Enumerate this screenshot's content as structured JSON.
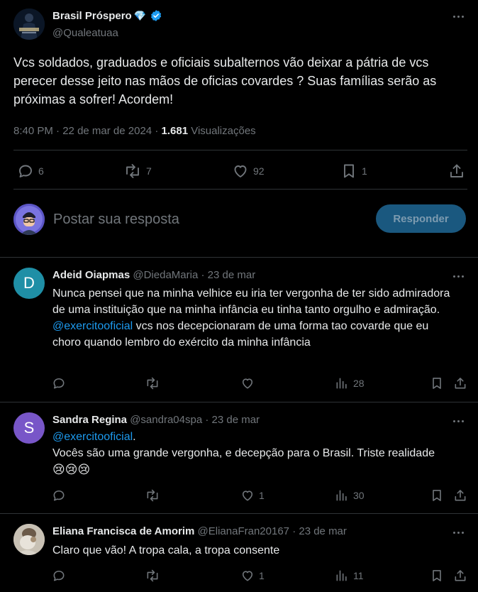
{
  "colors": {
    "background": "#000000",
    "text": "#e7e9ea",
    "muted": "#71767b",
    "accent": "#1d9bf0",
    "divider": "#2f3336",
    "verified": "#1d9bf0"
  },
  "main_post": {
    "author_name": "Brasil Próspero",
    "author_emoji": "💎",
    "verified_icon": "verified-badge-icon",
    "handle": "@Qualeatuaa",
    "text": "Vcs soldados, graduados e oficiais subalternos vão deixar a pátria de vcs perecer desse jeito nas mãos de oficias covardes ? Suas famílias serão as próximas a sofrer! Acordem!",
    "time": "8:40 PM",
    "date": "22 de mar de 2024",
    "views": "1.681",
    "views_label": "Visualizações",
    "actions": {
      "replies": "6",
      "reposts": "7",
      "likes": "92",
      "bookmarks": "1"
    }
  },
  "composer": {
    "placeholder": "Postar sua resposta",
    "button": "Responder"
  },
  "replies": [
    {
      "avatar_letter": "D",
      "avatar_color": "#1f8fa6",
      "name": "Adeid Oiapmas",
      "handle": "@DiedaMaria",
      "date": "23 de mar",
      "text_before": "Nunca pensei que na minha velhice eu iria ter vergonha de ter sido admiradora de uma instituição que na minha infância eu tinha tanto orgulho e admiração. ",
      "mention": "@exercitooficial",
      "text_after": " vcs nos decepcionaram de uma forma tao covarde que eu choro quando lembro do exército da minha infância",
      "actions": {
        "replies": "",
        "reposts": "",
        "likes": "",
        "views": "28"
      }
    },
    {
      "avatar_letter": "S",
      "avatar_color": "#7856c8",
      "name": "Sandra Regina",
      "handle": "@sandra04spa",
      "date": "23 de mar",
      "mention": "@exercitooficial",
      "mention_suffix": ".",
      "text": "Vocês são uma grande vergonha, e decepção para o Brasil. Triste realidade",
      "emojis": "😢😢😢",
      "actions": {
        "replies": "",
        "reposts": "",
        "likes": "1",
        "views": "30"
      }
    },
    {
      "name": "Eliana Francisca de Amorim",
      "handle": "@ElianaFran20167",
      "date": "23 de mar",
      "text": "Claro que vão! A tropa cala, a tropa consente",
      "actions": {
        "replies": "",
        "reposts": "",
        "likes": "1",
        "views": "11"
      }
    }
  ]
}
